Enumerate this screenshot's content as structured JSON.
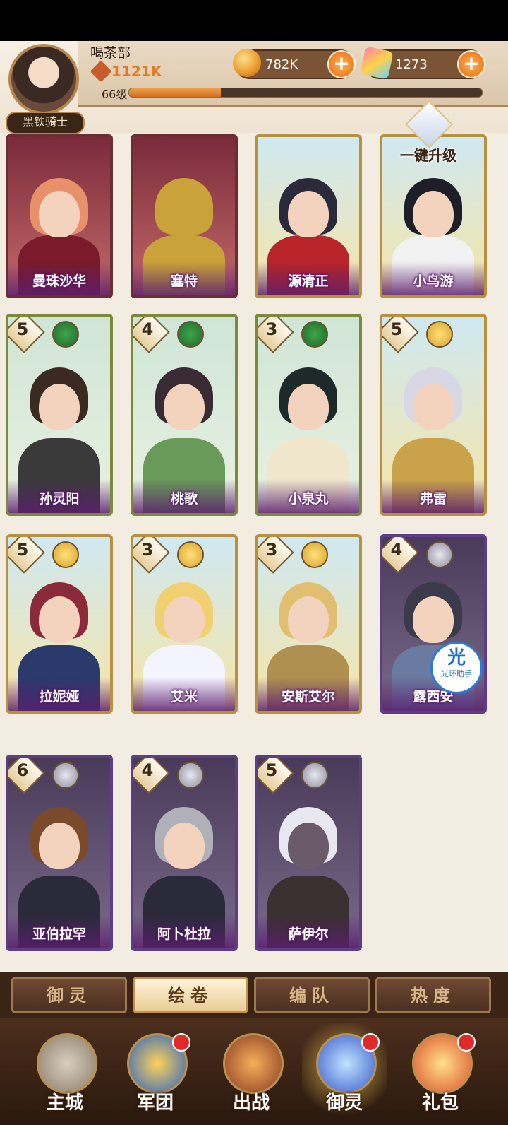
{
  "player": {
    "name": "喝茶部",
    "power": "1121K",
    "level": "66级",
    "level_progress": 0.26,
    "title": "黑铁骑士"
  },
  "resources": {
    "coins": "782K",
    "gems": "1273"
  },
  "upgrade_label": "一键升级",
  "cards": [
    {
      "name": "曼珠沙华",
      "theme": "red"
    },
    {
      "name": "塞特",
      "theme": "red"
    },
    {
      "name": "源清正",
      "theme": "gold"
    },
    {
      "name": "小鸟游",
      "theme": "gold"
    },
    {
      "name": "孙灵阳",
      "stars": "5",
      "element": "wind",
      "theme": "green"
    },
    {
      "name": "桃歌",
      "stars": "4",
      "element": "wind",
      "theme": "green"
    },
    {
      "name": "小泉丸",
      "stars": "3",
      "element": "wind",
      "theme": "green"
    },
    {
      "name": "弗雷",
      "stars": "5",
      "element": "rose",
      "theme": "gold"
    },
    {
      "name": "拉妮娅",
      "stars": "5",
      "element": "rose",
      "theme": "gold"
    },
    {
      "name": "艾米",
      "stars": "3",
      "element": "rose",
      "theme": "gold"
    },
    {
      "name": "安斯艾尔",
      "stars": "3",
      "element": "rose",
      "theme": "gold"
    },
    {
      "name": "露西安",
      "stars": "4",
      "element": "dark",
      "theme": "purple"
    },
    {
      "name": "亚伯拉罕",
      "stars": "6",
      "element": "dark",
      "theme": "purple"
    },
    {
      "name": "阿卜杜拉",
      "stars": "4",
      "element": "dark",
      "theme": "purple"
    },
    {
      "name": "萨伊尔",
      "stars": "5",
      "element": "dark",
      "theme": "purple"
    }
  ],
  "aura_badge": {
    "big": "光",
    "small": "光环助手"
  },
  "tabs": [
    "御灵",
    "绘卷",
    "编队",
    "热度"
  ],
  "active_tab": "绘卷",
  "nav": [
    "主城",
    "军团",
    "出战",
    "御灵",
    "礼包"
  ],
  "active_nav": "御灵",
  "colors": {
    "accent": "#e66a12",
    "purple": "#5d3c88",
    "gold": "#b89140",
    "green": "#7a8a3a"
  }
}
